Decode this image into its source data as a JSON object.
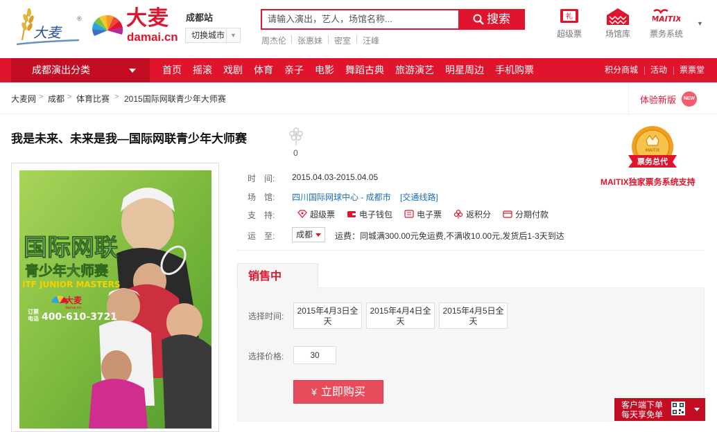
{
  "header": {
    "logo_wheat_text": "大麦",
    "logo_reg": "®",
    "logo_big": "大麦",
    "logo_domain": "damai.cn",
    "city": "成都站",
    "city_switch": "切换城市",
    "search_placeholder": "请输入演出，艺人，场馆名称...",
    "search_button": "搜索",
    "hot_keywords": [
      "周杰伦",
      "张惠妹",
      "密室",
      "汪峰"
    ],
    "tools": [
      {
        "label": "超级票",
        "icon": "gift-ticket-icon"
      },
      {
        "label": "场馆库",
        "icon": "venue-icon"
      },
      {
        "label": "票务系统",
        "icon": "maitix-icon"
      }
    ],
    "maitix_logo_text": "MAITIX"
  },
  "nav": {
    "category": "成都演出分类",
    "items": [
      "首页",
      "摇滚",
      "戏剧",
      "体育",
      "亲子",
      "电影",
      "舞蹈古典",
      "旅游演艺",
      "明星周边",
      "手机购票"
    ],
    "right": [
      "积分商城",
      "活动",
      "票票堂"
    ]
  },
  "breadcrumb": [
    "大麦网",
    "成都",
    "体育比赛",
    "2015国际网联青少年大师赛"
  ],
  "breadcrumb_sep": ">",
  "new_version": {
    "label": "体验新版",
    "badge": "NEW"
  },
  "event": {
    "title": "我是未来、未来是我—国际网联青少年大师赛",
    "fav_count": "0",
    "time_label": "时　间:",
    "time_value": "2015.04.03-2015.04.05",
    "venue_label": "场　馆:",
    "venue_value": "四川国际网球中心 - 成都市",
    "venue_link": "[交通线路]",
    "support_label": "支　持:",
    "support": [
      "超级票",
      "电子钱包",
      "电子票",
      "返积分",
      "分期付款"
    ],
    "ship_label": "运　至:",
    "ship_city": "成都",
    "shipping_text": "运费：同城满300.00元免运费,不满收10.00元,发货后1-3天到达"
  },
  "poster": {
    "line1": "国际网联",
    "line2": "青少年大师赛",
    "line3": "ITF JUNIOR MASTERS",
    "brand": "大麦",
    "brand_sub": "damai.cn",
    "phone_label1": "订票",
    "phone_label2": "电话",
    "phone": "400-610-3721"
  },
  "badge": {
    "ring_text": "MAITIX",
    "ribbon": "票务总代",
    "caption": "MAITIX独家票务系统支持"
  },
  "sale": {
    "tab": "销售中",
    "time_label": "选择时间:",
    "dates": [
      [
        "2015年4月3日全",
        "天"
      ],
      [
        "2015年4月4日全",
        "天"
      ],
      [
        "2015年4月5日全",
        "天"
      ]
    ],
    "price_label": "选择价格:",
    "price": "30",
    "buy_button": "立即购买",
    "buy_symbol": "¥"
  },
  "app_float": {
    "line1": "客户端下单",
    "line2": "每天享免单"
  },
  "colors": {
    "brand_red": "#e0142d",
    "dark_red": "#c20d23",
    "link_blue": "#1a6fb5",
    "poster_green": "#7dba3e"
  }
}
